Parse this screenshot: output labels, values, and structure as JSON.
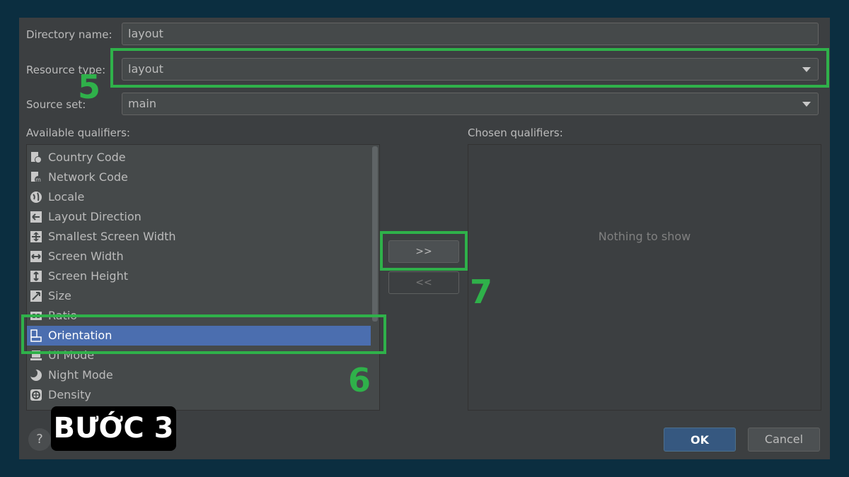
{
  "form": {
    "directory_name_label": "Directory name:",
    "directory_name_value": "layout",
    "resource_type_label": "Resource type:",
    "resource_type_value": "layout",
    "source_set_label": "Source set:",
    "source_set_value": "main"
  },
  "available": {
    "label": "Available qualifiers:",
    "items": [
      {
        "label": "Country Code",
        "icon": "country-code-icon"
      },
      {
        "label": "Network Code",
        "icon": "network-code-icon"
      },
      {
        "label": "Locale",
        "icon": "globe-icon"
      },
      {
        "label": "Layout Direction",
        "icon": "layout-direction-icon"
      },
      {
        "label": "Smallest Screen Width",
        "icon": "smallest-width-icon"
      },
      {
        "label": "Screen Width",
        "icon": "screen-width-icon"
      },
      {
        "label": "Screen Height",
        "icon": "screen-height-icon"
      },
      {
        "label": "Size",
        "icon": "size-icon"
      },
      {
        "label": "Ratio",
        "icon": "ratio-icon"
      },
      {
        "label": "Orientation",
        "icon": "orientation-icon",
        "selected": true
      },
      {
        "label": "UI Mode",
        "icon": "ui-mode-icon"
      },
      {
        "label": "Night Mode",
        "icon": "night-mode-icon"
      },
      {
        "label": "Density",
        "icon": "density-icon"
      }
    ]
  },
  "chosen": {
    "label": "Chosen qualifiers:",
    "empty_text": "Nothing to show"
  },
  "buttons": {
    "add": ">>",
    "remove": "<<",
    "ok": "OK",
    "cancel": "Cancel",
    "help": "?"
  },
  "annotations": {
    "step5": "5",
    "step6": "6",
    "step7": "7",
    "tag": "BƯỚC 3"
  },
  "colors": {
    "accent_green": "#2fb14a",
    "selection_blue": "#4b6eaf",
    "dialog_bg": "#3c3f41"
  }
}
